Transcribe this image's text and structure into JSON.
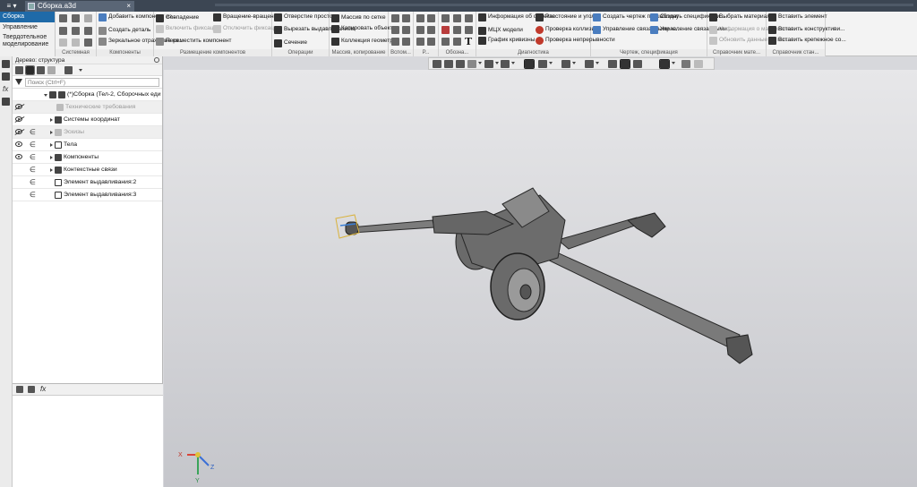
{
  "titlebar": {
    "app_menu": "≡ ▾",
    "tab_title": "Сборка.a3d",
    "close": "×"
  },
  "leftnav": {
    "items": [
      "Сборка",
      "Управление",
      "Твердотельное моделирование"
    ]
  },
  "ribbon": {
    "groups": [
      {
        "label": "Системная"
      },
      {
        "label": "Компоненты",
        "items": [
          "Добавить компонент из...",
          "Создать деталь",
          "Зеркальное отражение ко..."
        ]
      },
      {
        "label": "Размещение компонентов",
        "items": [
          "Совпадение",
          "Включить фиксацию",
          "Переместить компонент",
          "Вращение-вращение",
          "Отключить фиксацию"
        ]
      },
      {
        "label": "Операции",
        "items": [
          "Отверстие простое",
          "Вырезать выдавливанием",
          "Сечение"
        ]
      },
      {
        "label": "Массив, копирование",
        "items": [
          "Массив по сетке",
          "Копировать объекты",
          "Коллекция геометрии"
        ]
      },
      {
        "label": "Вспом..."
      },
      {
        "label": "Р..."
      },
      {
        "label": "Обозна..."
      },
      {
        "label": "Диагностика",
        "items": [
          "Информация об объекте",
          "МЦХ модели",
          "График кривизны",
          "Расстояние и угол",
          "Проверка коллизий",
          "Проверка непрерывности"
        ]
      },
      {
        "label": "Чертеж, спецификация",
        "items": [
          "Создать чертеж по шаблону",
          "Управление связанными ч...",
          "Создать спецификаци...",
          "Управление связанными ..."
        ]
      },
      {
        "label": "Справочник мате...",
        "items": [
          "Выбрать материал...",
          "Информация о материале...",
          "Обновить данные по мат..."
        ]
      },
      {
        "label": "Справочник стан...",
        "items": [
          "Вставить элемент",
          "Вставить конструктиви...",
          "Вставить крепежное со..."
        ]
      }
    ]
  },
  "tree": {
    "header": "Дерево: структура",
    "search_placeholder": "Поиск (Ctrl+F)",
    "rows": [
      {
        "label": "(*)Сборка (Тел-2, Сборочных еди"
      },
      {
        "label": "Технические требования"
      },
      {
        "label": "Системы координат"
      },
      {
        "label": "Эскизы"
      },
      {
        "label": "Тела"
      },
      {
        "label": "Компоненты"
      },
      {
        "label": "Контекстные связи"
      },
      {
        "label": "Элемент выдавливания:2"
      },
      {
        "label": "Элемент выдавливания:3"
      }
    ]
  },
  "panelbar": {
    "fx": "fx"
  },
  "lower_panel": {
    "fx": "fx"
  },
  "viewport": {
    "model": "howitzer-assembly",
    "axes": {
      "x": "X",
      "y": "Y",
      "z": "Z"
    }
  },
  "colors": {
    "accent": "#1f6aa8",
    "titlebar": "#3c4653",
    "model": "#7d7d7d"
  }
}
